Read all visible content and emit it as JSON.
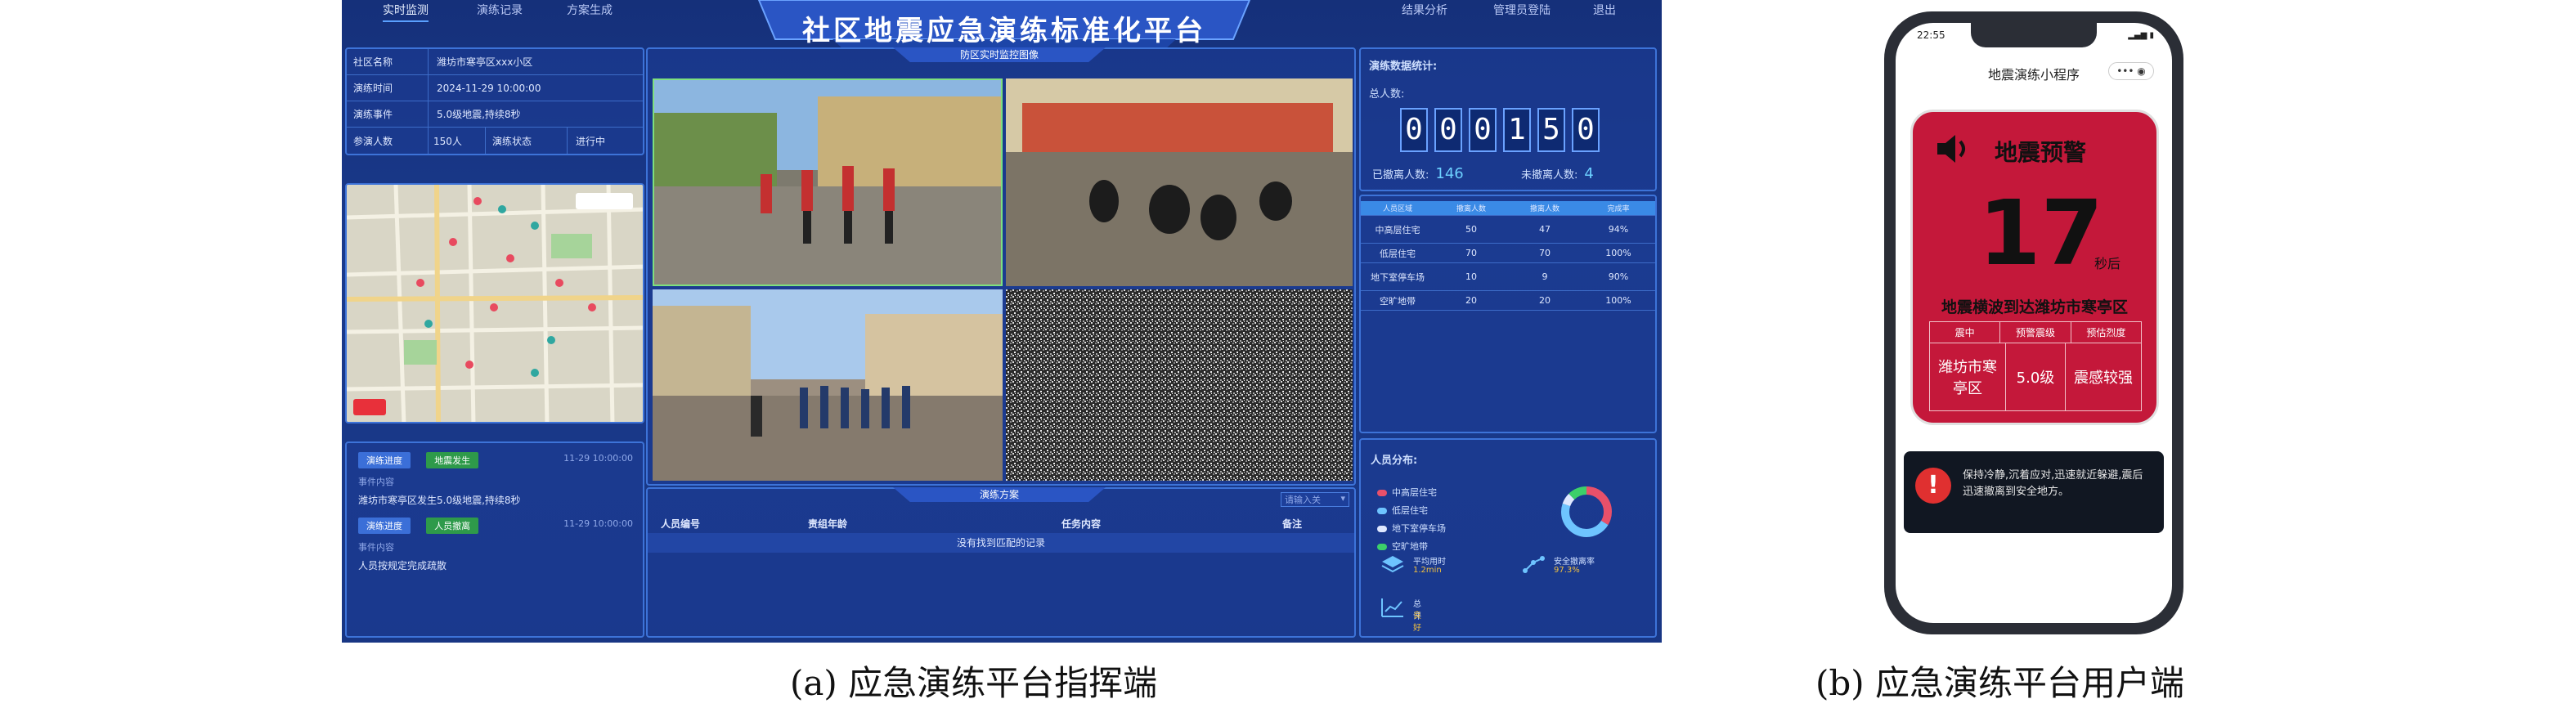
{
  "dashboard": {
    "nav": {
      "left_items": [
        "实时监测",
        "演练记录",
        "方案生成"
      ],
      "right_items": [
        "结果分析",
        "管理员登陆",
        "退出"
      ]
    },
    "title": "社区地震应急演练标准化平台",
    "video_title": "防区实时监控图像",
    "info": {
      "community_label": "社区名称",
      "community_value": "潍坊市寒亭区xxx小区",
      "time_label": "演练时间",
      "time_value": "2024-11-29 10:00:00",
      "event_label": "演练事件",
      "event_value": "5.0级地震,持续8秒",
      "participants_label": "参演人数",
      "participants_value": "150人",
      "status_label": "演练状态",
      "status_value": "进行中"
    },
    "log": [
      {
        "tag1": "演练进度",
        "tag2": "地震发生",
        "time": "11-29 10:00:00",
        "sub": "事件内容",
        "text": "潍坊市寒亭区发生5.0级地震,持续8秒"
      },
      {
        "tag1": "演练进度",
        "tag2": "人员撤离",
        "time": "11-29 10:00:00",
        "sub": "事件内容",
        "text": "人员按规定完成疏散"
      }
    ],
    "plan": {
      "title": "演练方案",
      "select": "请输入关",
      "headers": [
        "人员编号",
        "责组年龄",
        "任务内容",
        "备注"
      ],
      "empty": "没有找到匹配的记录"
    },
    "stats": {
      "title": "演练数据统计:",
      "total_label": "总人数:",
      "digits": [
        "0",
        "0",
        "0",
        "1",
        "5",
        "0"
      ],
      "evacuated_label": "已撤离人数:",
      "evacuated_value": "146",
      "not_evacuated_label": "未撤离人数:",
      "not_evacuated_value": "4"
    },
    "table": {
      "headers": [
        "人员区域",
        "撤离人数",
        "撤离人数",
        "完成率"
      ],
      "rows": [
        [
          "中高层住宅",
          "50",
          "47",
          "94%"
        ],
        [
          "低层住宅",
          "70",
          "70",
          "100%"
        ],
        [
          "地下室停车场",
          "10",
          "9",
          "90%"
        ],
        [
          "空旷地带",
          "20",
          "20",
          "100%"
        ]
      ]
    },
    "distribution": {
      "title": "人员分布:",
      "legend": [
        {
          "label": "中高层住宅",
          "color": "#e8506a"
        },
        {
          "label": "低层住宅",
          "color": "#6ec4ff"
        },
        {
          "label": "地下室停车场",
          "color": "#dfe8ff"
        },
        {
          "label": "空旷地带",
          "color": "#3cd06a"
        }
      ],
      "metrics": [
        {
          "label": "平均用时",
          "value": "1.2min"
        },
        {
          "label": "安全撤离率",
          "value": "97.3%"
        },
        {
          "label": "总评",
          "value": "良好"
        }
      ]
    }
  },
  "phone": {
    "time": "22:55",
    "app_title": "地震演练小程序",
    "alert_title": "地震预警",
    "countdown": "17",
    "countdown_unit": "秒后",
    "message": "地震横波到达潍坊市寒亭区",
    "table_headers": [
      "震中",
      "预警震级",
      "预估烈度"
    ],
    "table_values": [
      "潍坊市寒亭区",
      "5.0级",
      "震感较强"
    ],
    "warning": "保持冷静,沉着应对,迅速就近躲避,震后迅速撤离到安全地方。"
  },
  "captions": {
    "left": "(a) 应急演练平台指挥端",
    "right": "(b) 应急演练平台用户端"
  }
}
